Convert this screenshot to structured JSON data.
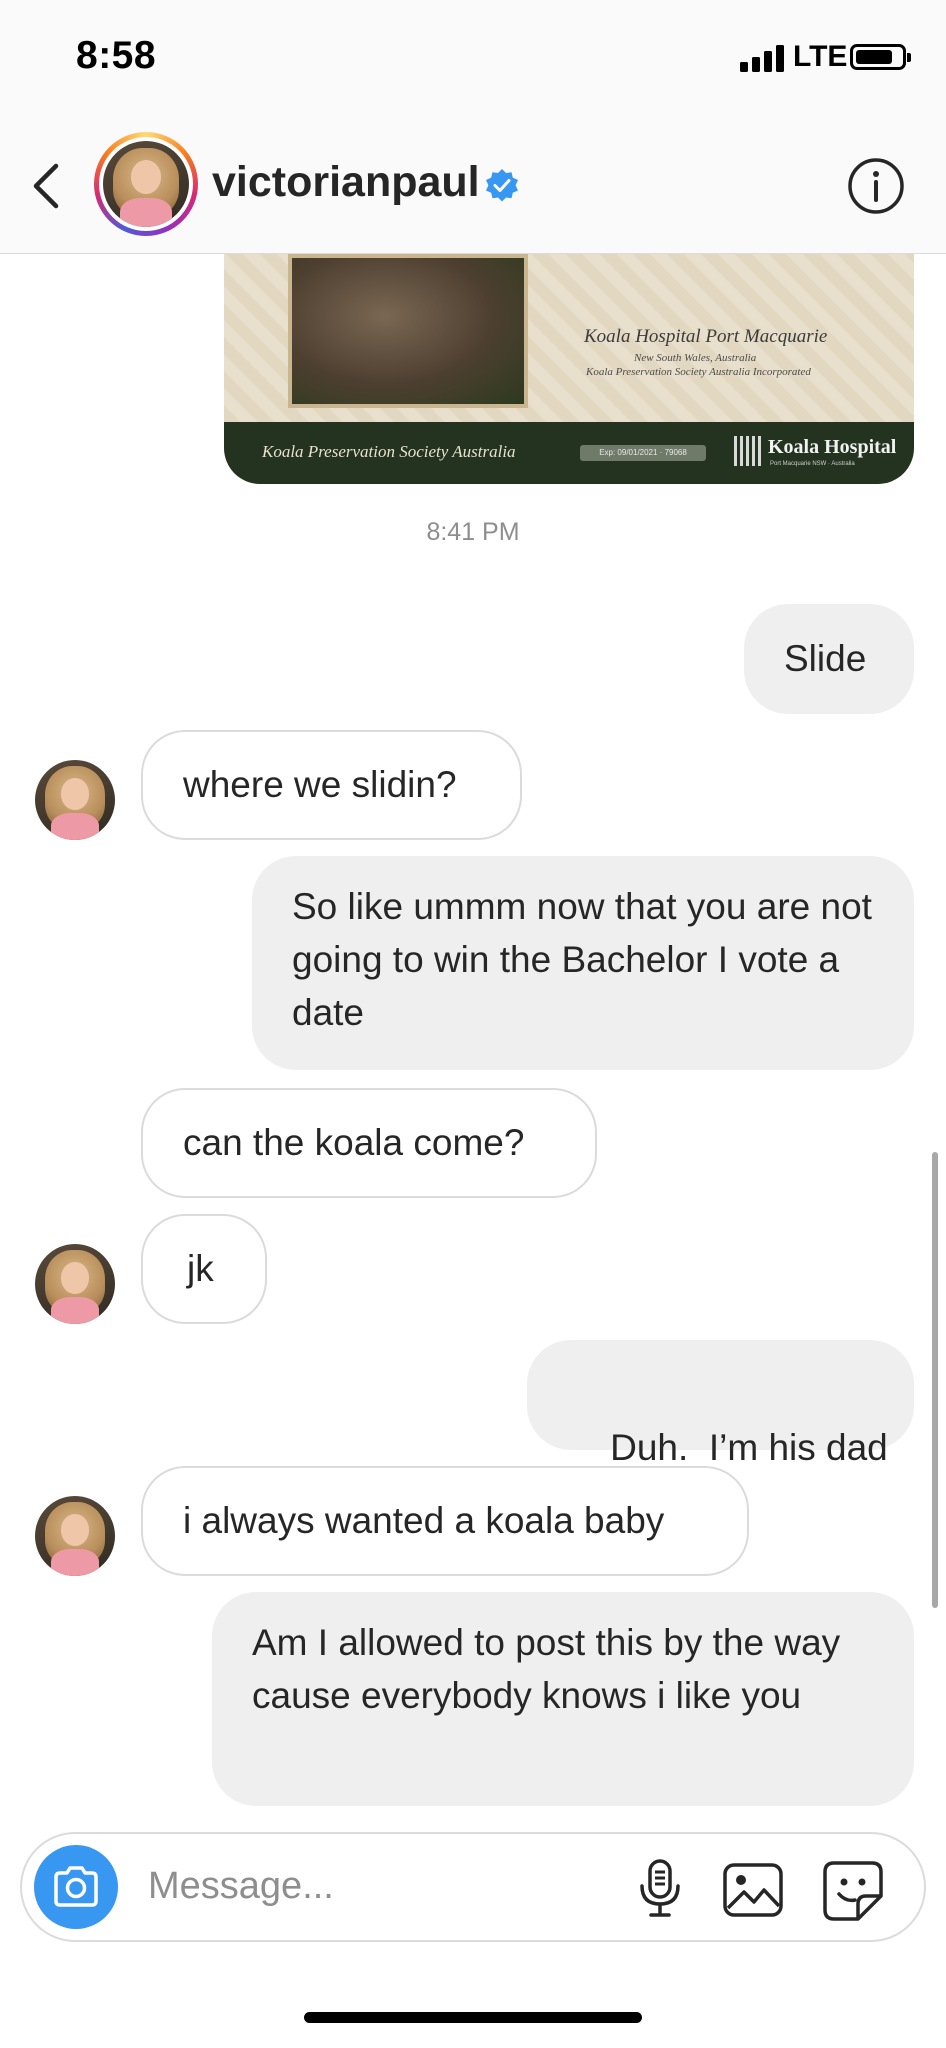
{
  "status_bar": {
    "time": "8:58",
    "network": "LTE"
  },
  "header": {
    "username": "victorianpaul",
    "verified": true
  },
  "shared_card": {
    "title": "Koala Hospital Port Macquarie",
    "subtitle1": "New South Wales, Australia",
    "subtitle2": "Koala Preservation Society Australia Incorporated",
    "footer_left": "Koala Preservation Society Australia",
    "expiry": "Exp: 09/01/2021 · 79068",
    "footer_right": "Koala Hospital",
    "footer_right_sub": "Port Macquarie NSW · Australia"
  },
  "timestamp": "8:41 PM",
  "messages": [
    {
      "from": "me",
      "text": "Slide"
    },
    {
      "from": "them",
      "text": "where we slidin?"
    },
    {
      "from": "me",
      "text": "So like ummm now that you are not going to win the Bachelor I vote a date"
    },
    {
      "from": "them",
      "text": "can the koala come?"
    },
    {
      "from": "them",
      "text": "jk"
    },
    {
      "from": "me",
      "text": "Duh.  I’m his dad"
    },
    {
      "from": "them",
      "text": "i always wanted a koala baby"
    },
    {
      "from": "me",
      "text": "Am I allowed to post this by the way cause everybody knows i like you"
    }
  ],
  "composer": {
    "placeholder": "Message..."
  },
  "colors": {
    "accent": "#3897f0",
    "outgoing_bubble": "#efefef",
    "incoming_border": "#dbdbdb",
    "verified": "#3897f0"
  },
  "icons": [
    "back-chevron-icon",
    "verified-badge-icon",
    "info-icon",
    "camera-icon",
    "microphone-icon",
    "gallery-icon",
    "sticker-icon"
  ]
}
